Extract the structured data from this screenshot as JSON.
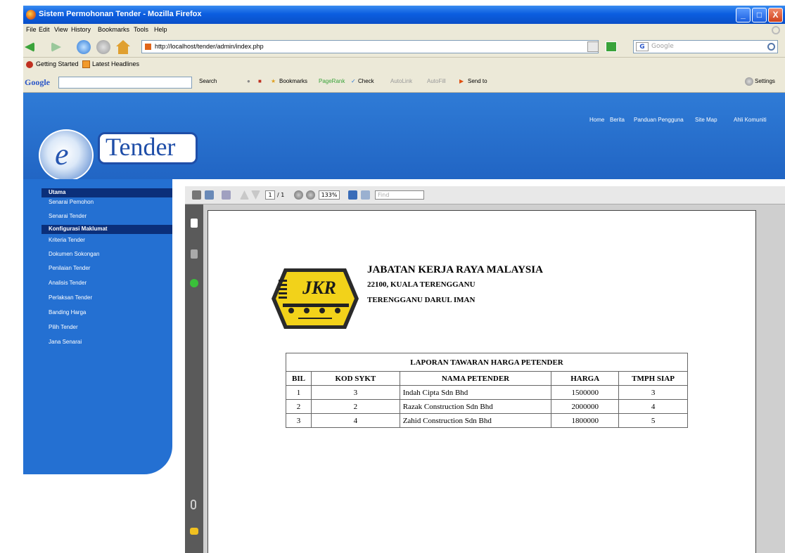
{
  "window": {
    "title": "Sistem Permohonan Tender - Mozilla Firefox",
    "controls": [
      "_",
      "□",
      "X"
    ]
  },
  "menu": [
    "File",
    "Edit",
    "View",
    "History",
    "Bookmarks",
    "Tools",
    "Help"
  ],
  "navbar": {
    "url": "http://localhost/tender/admin/index.php",
    "search_placeholder": "Google"
  },
  "bookmarks": [
    "Getting Started",
    "Latest Headlines"
  ],
  "google_toolbar": {
    "logo": "Google",
    "items": [
      "Search",
      "Bookmarks",
      "PageRank",
      "Check",
      "AutoLink",
      "AutoFill",
      "Send to"
    ],
    "settings": "Settings"
  },
  "site": {
    "logo_e": "e",
    "logo_text": "Tender",
    "top_nav": [
      "Home",
      "Berita",
      "Panduan Pengguna",
      "Site Map",
      "Ahli Komuniti"
    ]
  },
  "sidebar": {
    "heading1": "Utama",
    "items1": [
      "Senarai Pemohon",
      "Senarai Tender"
    ],
    "heading2": "Konfigurasi Maklumat",
    "items2": [
      "Kriteria Tender",
      "Dokumen Sokongan",
      "Penilaian Tender",
      "Analisis Tender",
      "Perlaksan Tender",
      "Banding Harga",
      "Pilih Tender",
      "Jana Senarai"
    ]
  },
  "pdf_toolbar": {
    "page": "1",
    "pages": "/ 1",
    "zoom": "133%",
    "find": "Find"
  },
  "document": {
    "logo_text": "JKR",
    "org_name": "JABATAN KERJA RAYA MALAYSIA",
    "address1": "22100, KUALA TERENGGANU",
    "address2": "TERENGGANU DARUL IMAN",
    "table_title": "LAPORAN TAWARAN HARGA PETENDER",
    "columns": [
      "BIL",
      "KOD SYKT",
      "NAMA PETENDER",
      "HARGA",
      "TMPH SIAP"
    ],
    "rows": [
      [
        "1",
        "3",
        "Indah Cipta Sdn Bhd",
        "1500000",
        "3"
      ],
      [
        "2",
        "2",
        "Razak Construction Sdn Bhd",
        "2000000",
        "4"
      ],
      [
        "3",
        "4",
        "Zahid Construction Sdn Bhd",
        "1800000",
        "5"
      ]
    ]
  },
  "colors": {
    "banner": "#2470d2",
    "sidebar_heading": "#0b2f7a",
    "jkr_yellow": "#f2d21a"
  }
}
